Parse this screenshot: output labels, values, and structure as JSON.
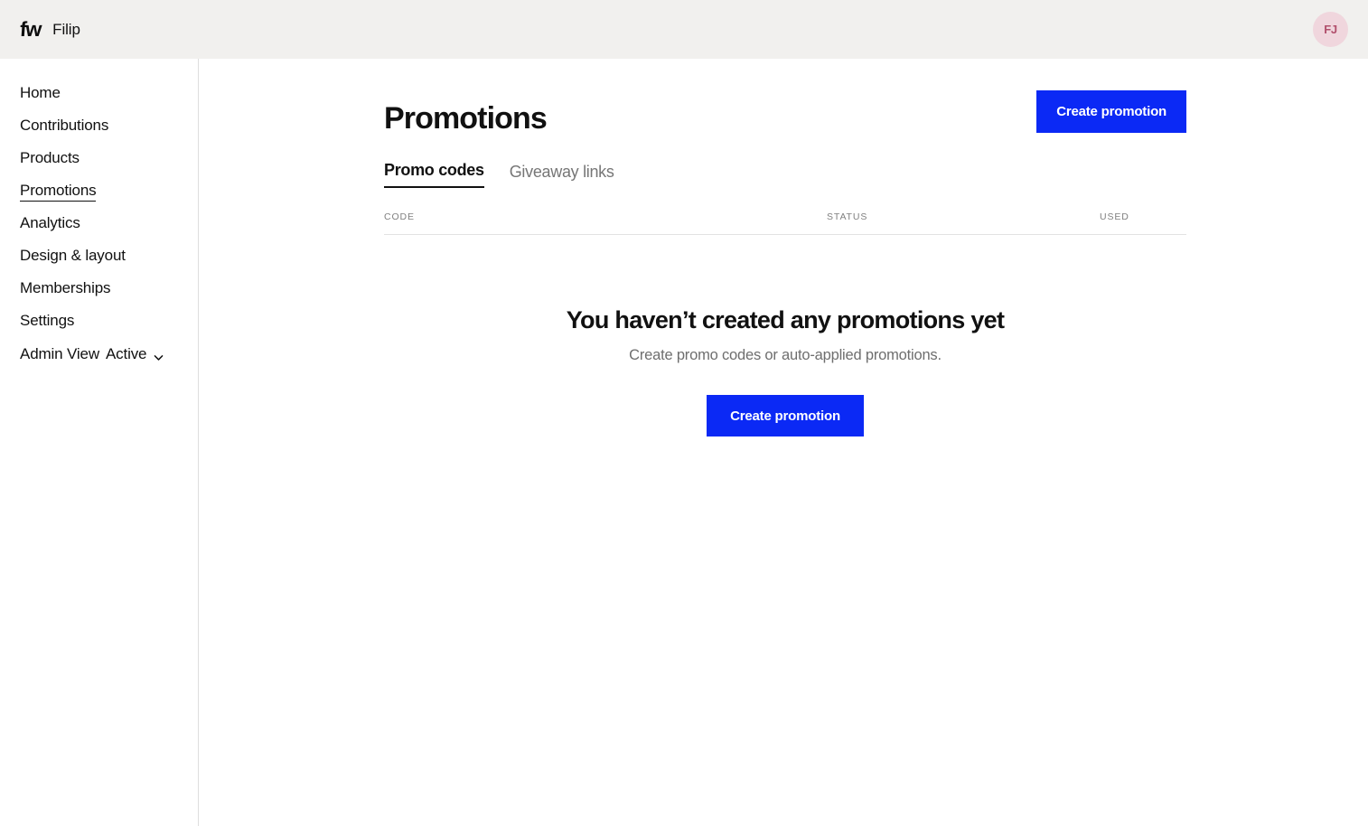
{
  "topbar": {
    "logo_text": "fw",
    "logo_icon": "fw-logo-icon",
    "brand_name": "Filip",
    "avatar_initials": "FJ",
    "avatar_bg": "#f0d6dd",
    "avatar_fg": "#b14f6c",
    "background": "#f1f0ee"
  },
  "sidebar": {
    "items": [
      {
        "label": "Home",
        "active": false
      },
      {
        "label": "Contributions",
        "active": false
      },
      {
        "label": "Products",
        "active": false
      },
      {
        "label": "Promotions",
        "active": true
      },
      {
        "label": "Analytics",
        "active": false
      },
      {
        "label": "Design & layout",
        "active": false
      },
      {
        "label": "Memberships",
        "active": false
      },
      {
        "label": "Settings",
        "active": false
      }
    ],
    "admin": {
      "label": "Admin View",
      "value": "Active",
      "chevron_icon": "chevron-down-icon"
    }
  },
  "main": {
    "page_title": "Promotions",
    "create_button": "Create promotion",
    "accent_color": "#0b29f5",
    "tabs": [
      {
        "label": "Promo codes",
        "active": true
      },
      {
        "label": "Giveaway links",
        "active": false
      }
    ],
    "table": {
      "columns": [
        {
          "key": "code",
          "label": "CODE"
        },
        {
          "key": "status",
          "label": "STATUS"
        },
        {
          "key": "used",
          "label": "USED"
        }
      ],
      "rows": []
    },
    "empty_state": {
      "title": "You haven’t created any promotions yet",
      "subtitle": "Create promo codes or auto-applied promotions.",
      "cta_label": "Create promotion"
    }
  }
}
